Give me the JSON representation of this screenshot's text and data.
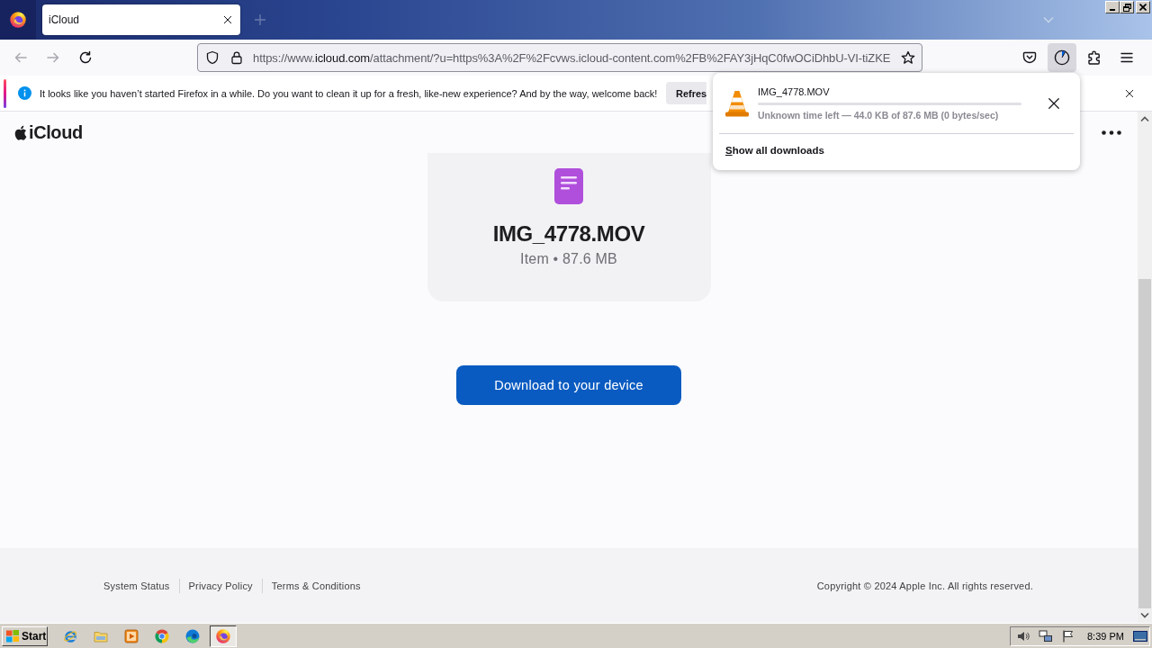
{
  "title_bar": {
    "tabs": [
      {
        "title": "iCloud",
        "selected": true
      }
    ]
  },
  "nav_bar": {
    "buttons": [
      {
        "kind": "back",
        "disabled": true
      },
      {
        "kind": "forward",
        "disabled": true
      },
      {
        "kind": "reload",
        "disabled": false
      }
    ],
    "url": {
      "prefix": "https://www.",
      "domain": "icloud.com",
      "path": "/attachment/?u=https%3A%2F%2Fcvws.icloud-content.com%2FB%2FAY3jHqC0fwOCiDhbU-VI-tiZKE"
    },
    "toolbar_buttons": [
      {
        "kind": "pocket",
        "active": false
      },
      {
        "kind": "downloads",
        "active": true
      },
      {
        "kind": "extensions",
        "active": false
      },
      {
        "kind": "menu",
        "active": false
      }
    ]
  },
  "notification": {
    "message": "It looks like you haven’t started Firefox in a while. Do you want to clean it up for a fresh, like-new experience? And by the way, welcome back!",
    "button": "Refres"
  },
  "downloads_panel": {
    "items": [
      {
        "file_name": "IMG_4778.MOV",
        "status": "Unknown time left — 44.0 KB of 87.6 MB (0 bytes/sec)"
      }
    ],
    "show_all": "Show all downloads"
  },
  "page": {
    "brand": "iCloud",
    "file": {
      "name": "IMG_4778.MOV",
      "details": "Item • 87.6 MB"
    },
    "download_button": "Download to your device",
    "footer": {
      "links": [
        "System Status",
        "Privacy Policy",
        "Terms & Conditions"
      ],
      "copyright": "Copyright © 2024 Apple Inc. All rights reserved."
    }
  },
  "taskbar": {
    "start": "Start",
    "apps": [
      {
        "kind": "ie",
        "active": false
      },
      {
        "kind": "explorer",
        "active": false
      },
      {
        "kind": "media",
        "active": false
      },
      {
        "kind": "chrome",
        "active": false
      },
      {
        "kind": "edge",
        "active": false
      },
      {
        "kind": "firefox",
        "active": true
      }
    ],
    "clock": "8:39 PM"
  }
}
